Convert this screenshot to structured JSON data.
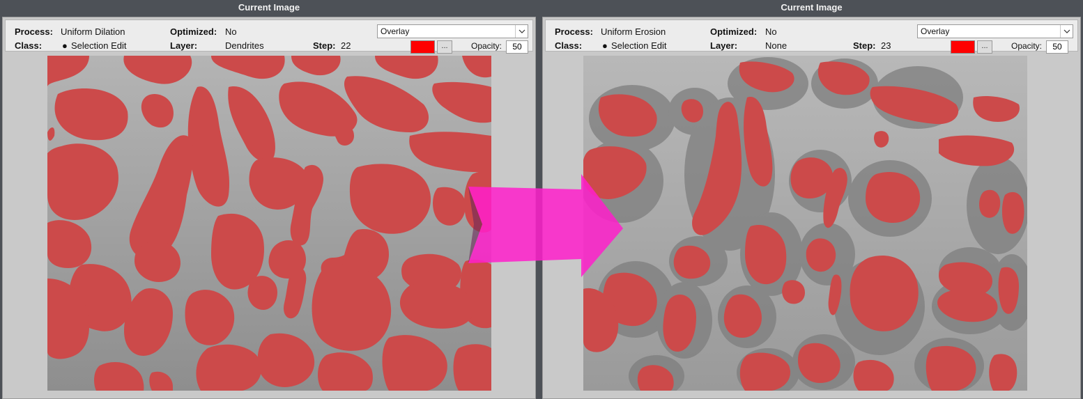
{
  "left_pane": {
    "title": "Current Image",
    "process_label": "Process:",
    "process_value": "Uniform Dilation",
    "optimized_label": "Optimized:",
    "optimized_value": "No",
    "class_label": "Class:",
    "class_value": "Selection Edit",
    "layer_label": "Layer:",
    "layer_value": "Dendrites",
    "step_label": "Step:",
    "step_value": "22",
    "mode_value": "Overlay",
    "opacity_label": "Opacity:",
    "opacity_value": "50",
    "overlay_color": "#ff0000",
    "dots_label": "..."
  },
  "right_pane": {
    "title": "Current Image",
    "process_label": "Process:",
    "process_value": "Uniform Erosion",
    "optimized_label": "Optimized:",
    "optimized_value": "No",
    "class_label": "Class:",
    "class_value": "Selection Edit",
    "layer_label": "Layer:",
    "layer_value": "None",
    "step_label": "Step:",
    "step_value": "23",
    "mode_value": "Overlay",
    "opacity_label": "Opacity:",
    "opacity_value": "50",
    "overlay_color": "#ff0000",
    "dots_label": "..."
  },
  "colors": {
    "overlay_red": "#cc4a4a",
    "matrix_gray": "#9c9c9c",
    "arrow_magenta": "#ff1ecb"
  },
  "icons": [
    "bullet-icon",
    "chevron-down-icon",
    "arrow-icon"
  ]
}
